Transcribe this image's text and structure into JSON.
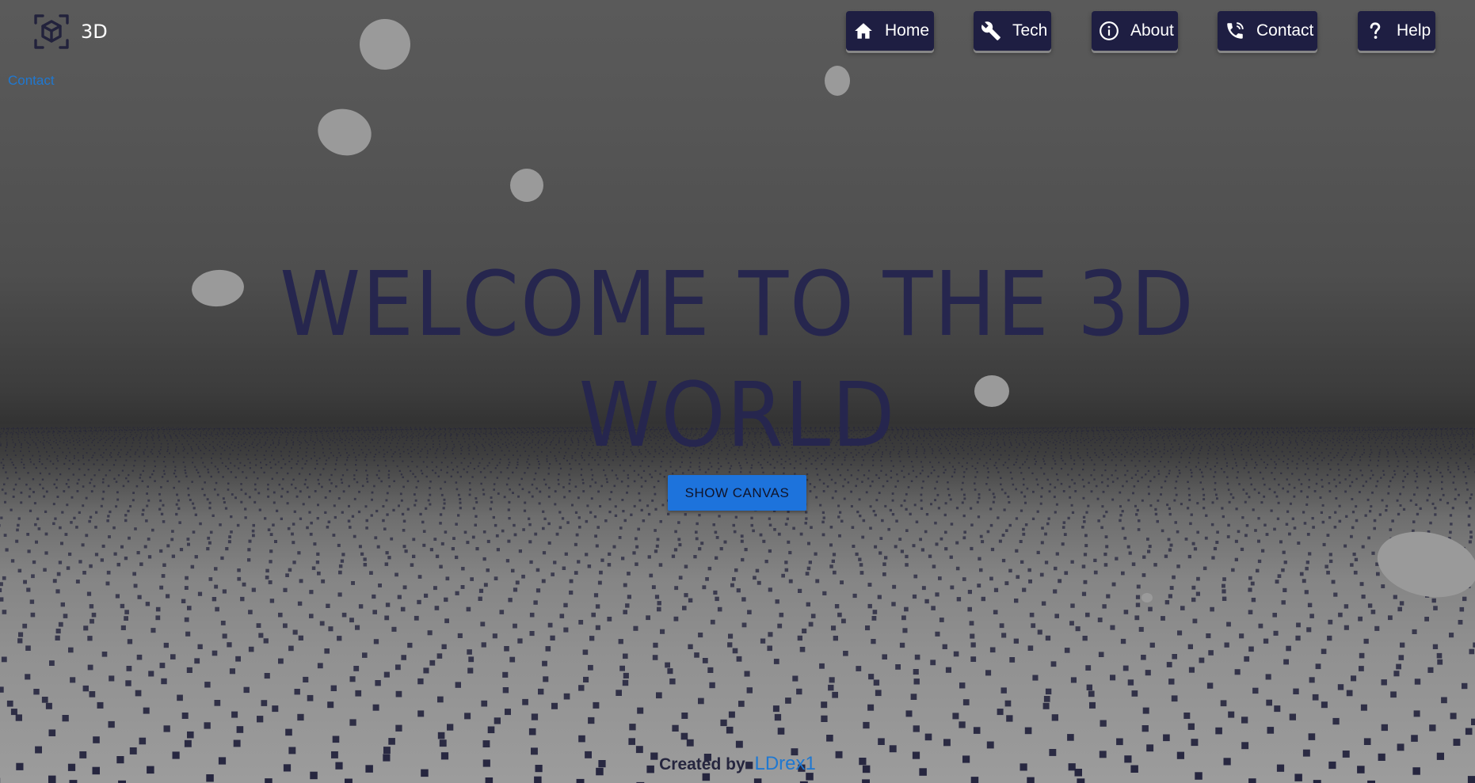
{
  "brand": {
    "logo_icon": "cube-icon",
    "name": "3D"
  },
  "side_link": "Contact",
  "nav": [
    {
      "id": "home",
      "label": "Home",
      "icon": "home-icon"
    },
    {
      "id": "tech",
      "label": "Tech",
      "icon": "wrench-icon"
    },
    {
      "id": "about",
      "label": "About",
      "icon": "info-icon"
    },
    {
      "id": "contact",
      "label": "Contact",
      "icon": "phone-icon"
    },
    {
      "id": "help",
      "label": "Help",
      "icon": "question-icon"
    }
  ],
  "hero": {
    "line1": "WELCOME TO THE 3D",
    "line2": "WORLD",
    "button_label": "SHOW CANVAS"
  },
  "footer": {
    "prefix": "Created by",
    "author": "LDrex1"
  },
  "colors": {
    "nav_bg": "#1e1e42",
    "accent": "#1d73dc",
    "link": "#1f78d1",
    "headline": "#26264e",
    "particle": "#22223c",
    "sphere": "#9a9a9a"
  }
}
